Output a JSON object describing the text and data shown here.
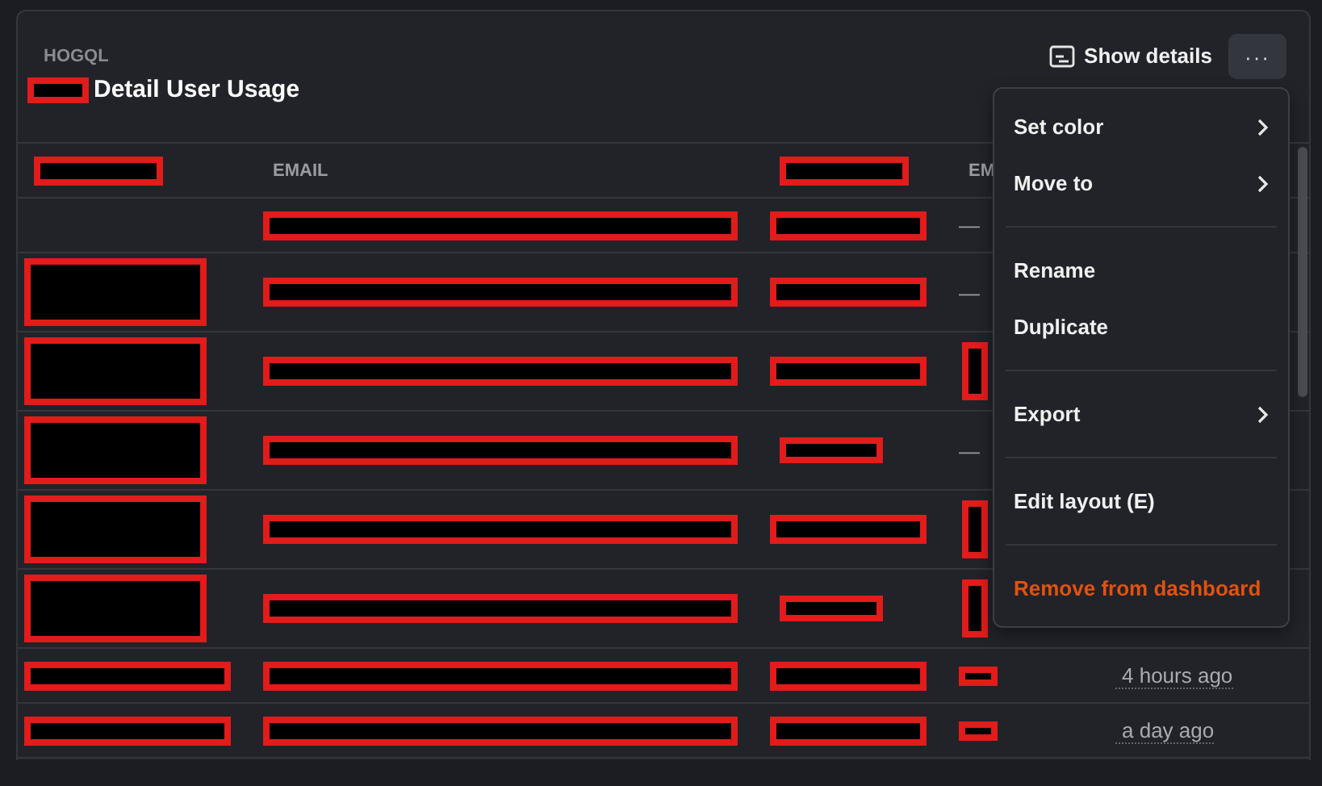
{
  "card": {
    "kind_label": "HOGQL",
    "title": "Detail User Usage",
    "title_redacted": true,
    "show_details": "Show details",
    "more_button": "···"
  },
  "table": {
    "columns": [
      {
        "kind": "redacted"
      },
      {
        "kind": "text",
        "label": "EMAIL"
      },
      {
        "kind": "redacted"
      },
      {
        "kind": "text",
        "label": "EM"
      }
    ],
    "rows": [
      {
        "cells": [
          null,
          {
            "kind": "line"
          },
          {
            "kind": "line"
          },
          {
            "kind": "text",
            "text": "—"
          }
        ]
      },
      {
        "cells": [
          {
            "kind": "block"
          },
          {
            "kind": "line"
          },
          {
            "kind": "line"
          },
          {
            "kind": "text",
            "text": "—"
          }
        ]
      },
      {
        "cells": [
          {
            "kind": "block"
          },
          {
            "kind": "line"
          },
          {
            "kind": "line"
          },
          {
            "kind": "narrow"
          }
        ]
      },
      {
        "cells": [
          {
            "kind": "block"
          },
          {
            "kind": "line"
          },
          {
            "kind": "short"
          },
          {
            "kind": "text",
            "text": "—"
          }
        ]
      },
      {
        "cells": [
          {
            "kind": "block"
          },
          {
            "kind": "line"
          },
          {
            "kind": "line"
          },
          {
            "kind": "narrow"
          }
        ]
      },
      {
        "cells": [
          {
            "kind": "block"
          },
          {
            "kind": "line"
          },
          {
            "kind": "short"
          },
          {
            "kind": "narrow"
          }
        ]
      },
      {
        "cells": [
          {
            "kind": "line"
          },
          {
            "kind": "line"
          },
          {
            "kind": "line"
          },
          {
            "kind": "bar"
          },
          {
            "kind": "time",
            "text": "4 hours ago"
          }
        ]
      },
      {
        "cells": [
          {
            "kind": "line"
          },
          {
            "kind": "line"
          },
          {
            "kind": "line"
          },
          {
            "kind": "bar"
          },
          {
            "kind": "time",
            "text": "a day ago"
          }
        ]
      }
    ]
  },
  "menu": {
    "groups": [
      [
        {
          "label": "Set color",
          "submenu": true,
          "danger": false
        },
        {
          "label": "Move to",
          "submenu": true,
          "danger": false
        }
      ],
      [
        {
          "label": "Rename",
          "submenu": false,
          "danger": false
        },
        {
          "label": "Duplicate",
          "submenu": false,
          "danger": false
        }
      ],
      [
        {
          "label": "Export",
          "submenu": true,
          "danger": false
        }
      ],
      [
        {
          "label": "Edit layout (E)",
          "submenu": false,
          "danger": false
        }
      ],
      [
        {
          "label": "Remove from dashboard",
          "submenu": false,
          "danger": true
        }
      ]
    ]
  }
}
